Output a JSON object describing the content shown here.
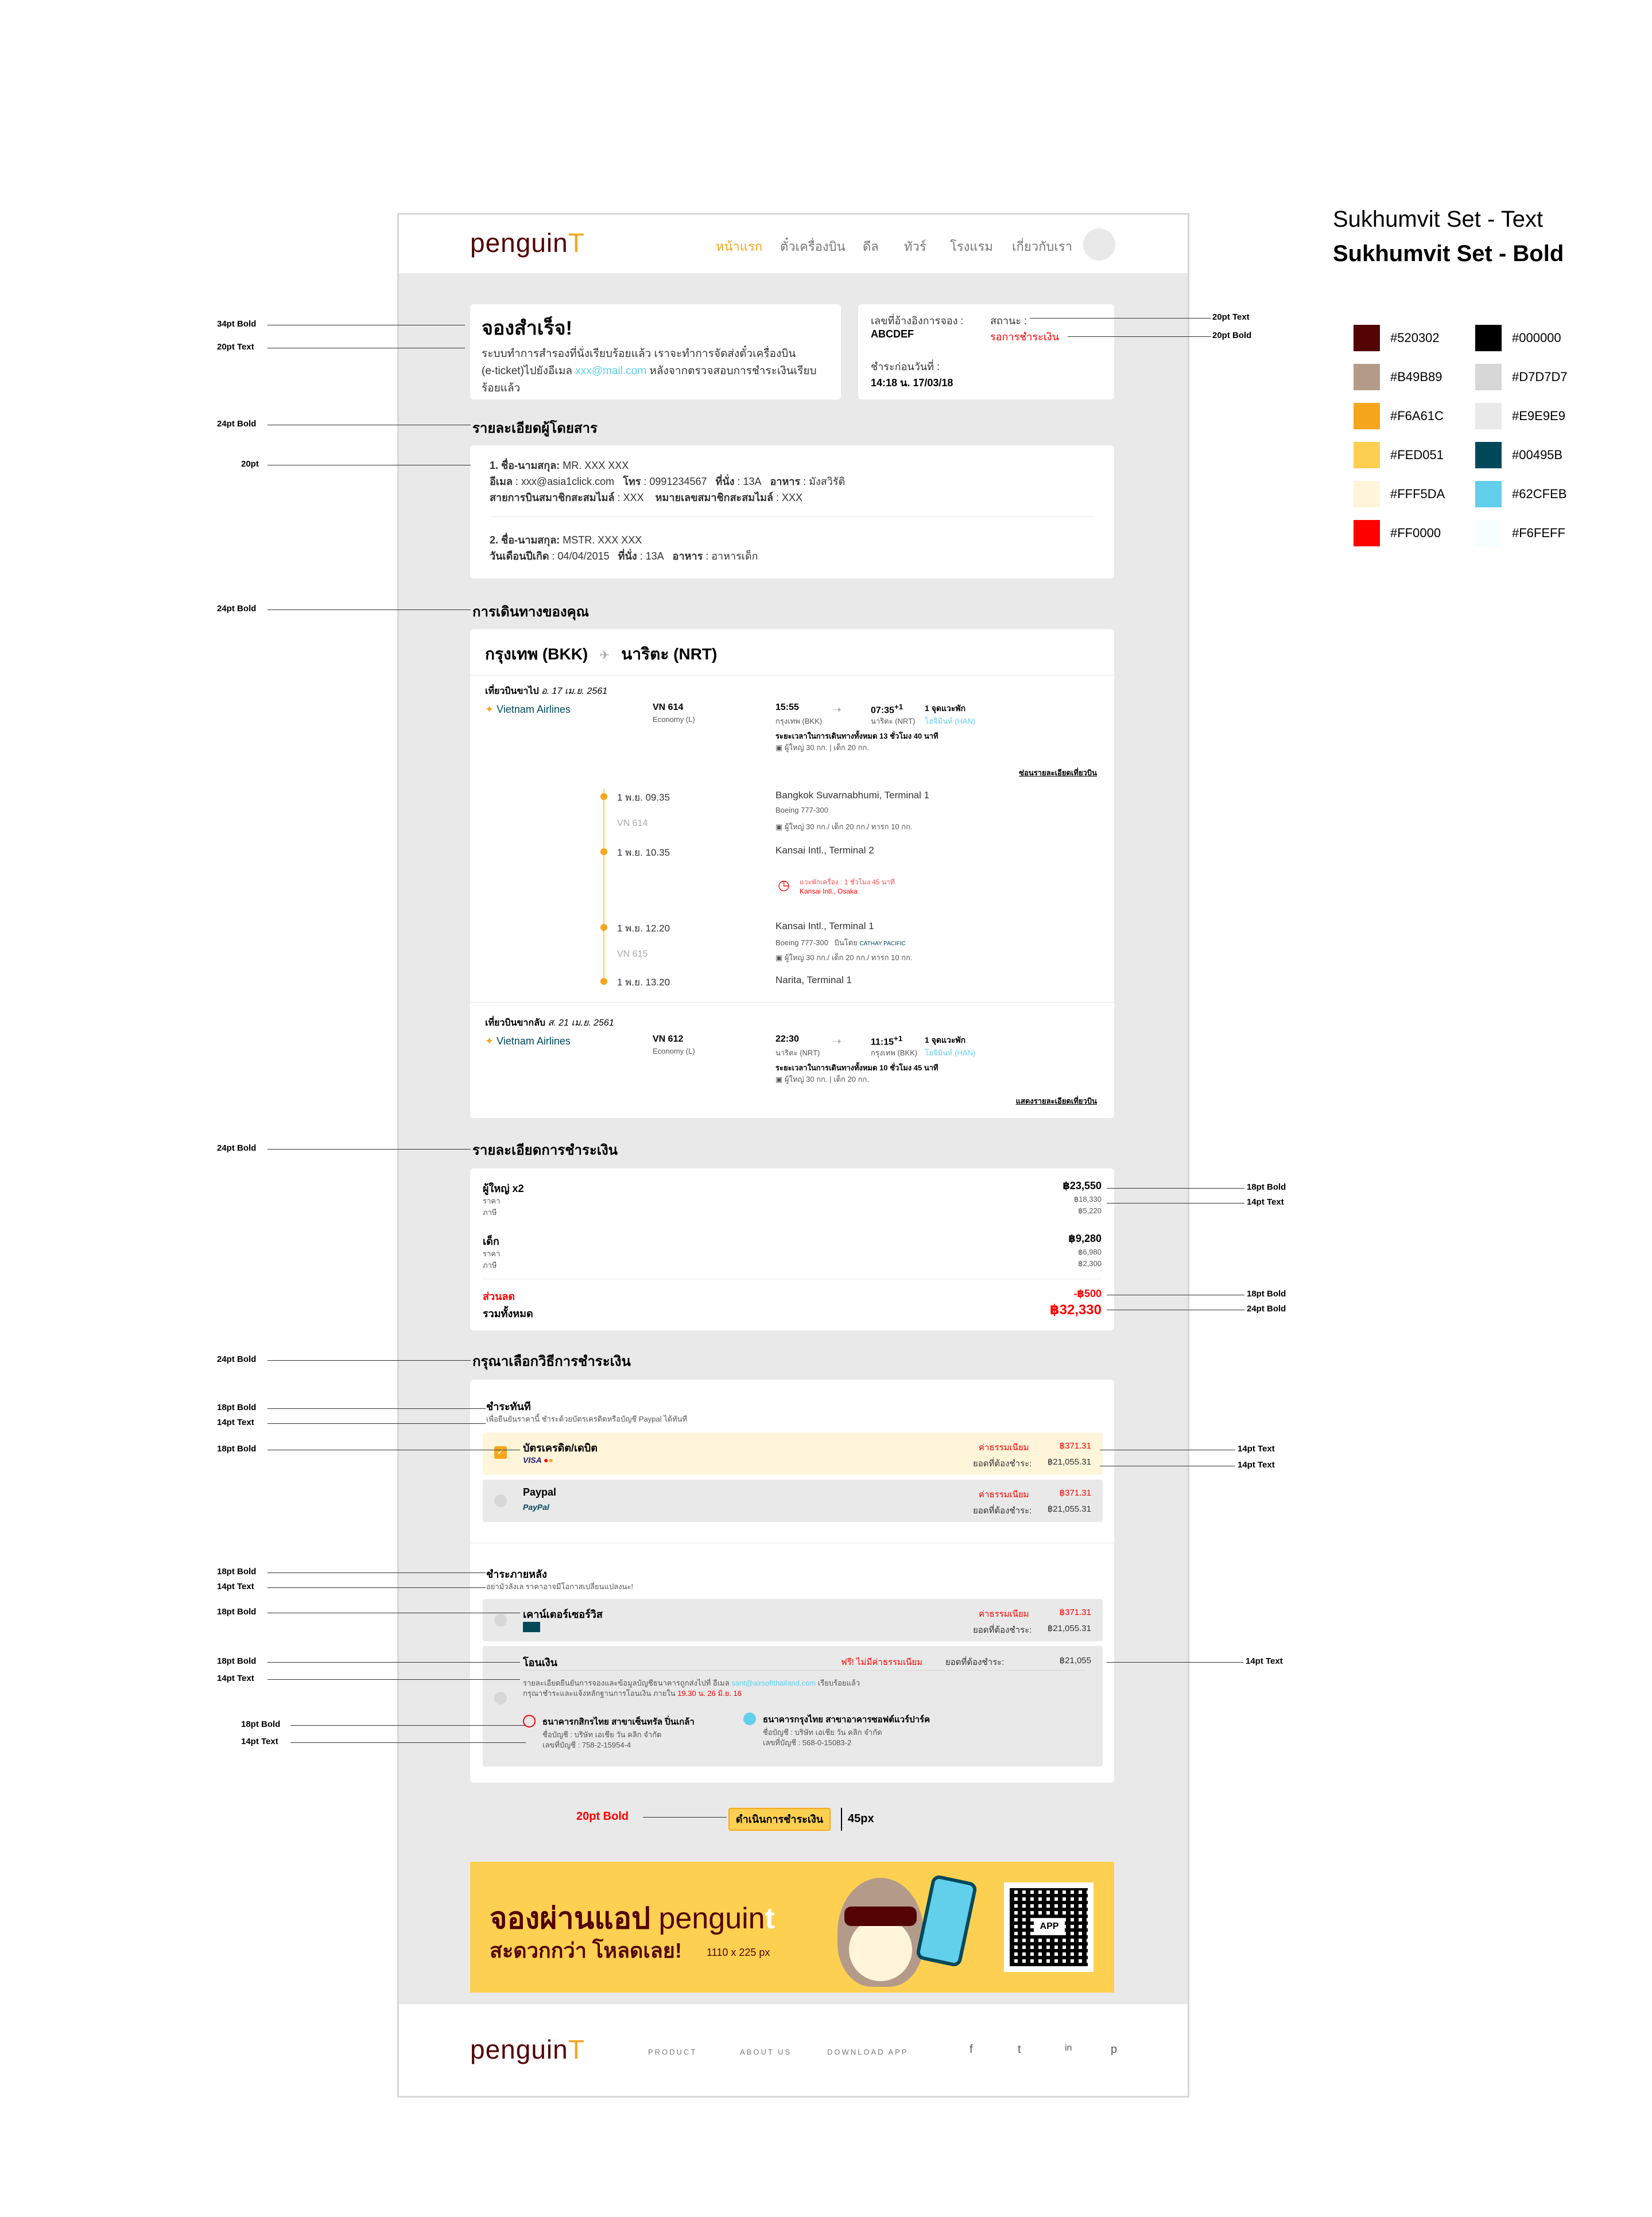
{
  "font_labels": {
    "text": "Sukhumvit Set - Text",
    "bold": "Sukhumvit Set - Bold"
  },
  "swatches": [
    {
      "hex": "#520302",
      "label": "#520302"
    },
    {
      "hex": "#000000",
      "label": "#000000"
    },
    {
      "hex": "#B49B89",
      "label": "#B49B89"
    },
    {
      "hex": "#D7D7D7",
      "label": "#D7D7D7"
    },
    {
      "hex": "#F6A61C",
      "label": "#F6A61C"
    },
    {
      "hex": "#E9E9E9",
      "label": "#E9E9E9"
    },
    {
      "hex": "#FED051",
      "label": "#FED051"
    },
    {
      "hex": "#00495B",
      "label": "#00495B"
    },
    {
      "hex": "#FFF5DA",
      "label": "#FFF5DA"
    },
    {
      "hex": "#62CFEB",
      "label": "#62CFEB"
    },
    {
      "hex": "#FF0000",
      "label": "#FF0000"
    },
    {
      "hex": "#F6FEFF",
      "label": "#F6FEFF"
    }
  ],
  "header": {
    "logo": "penguin",
    "logo_t": "T",
    "nav": [
      "หน้าแรก",
      "ตั๋วเครื่องบิน",
      "ดีล",
      "ทัวร์",
      "โรงแรม",
      "เกี่ยวกับเรา"
    ]
  },
  "success": {
    "title": "จองสำเร็จ!",
    "line1": "ระบบทำการสำรองที่นั่งเรียบร้อยแล้ว เราจะทำการจัดส่งตั๋วเครื่องบิน",
    "line2_a": "(e-ticket)ไปยังอีเมล ",
    "line2_email": "xxx@mail.com",
    "line2_b": " หลังจากตรวจสอบการชำระเงินเรียบ",
    "line3": "ร้อยแล้ว"
  },
  "booking": {
    "ref_label": "เลขที่อ้างอิงการจอง :",
    "ref_value": "ABCDEF",
    "status_label": "สถานะ :",
    "status_value": "รอการชำระเงิน",
    "due_label": "ชำระก่อนวันที่ :",
    "due_value": "14:18 น. 17/03/18"
  },
  "passenger_section": "รายละเอียดผู้โดยสาร",
  "passengers": [
    {
      "line1_label": "1. ชื่อ-นามสกุล:",
      "line1_value": " MR. XXX XXX",
      "email_label": "อีเมล",
      "email_value": " : xxx@asia1click.com",
      "tel_label": "โทร",
      "tel_value": " : 0991234567",
      "seat_label": "ที่นั่ง",
      "seat_value": " : 13A",
      "food_label": "อาหาร",
      "food_value": " : มังสวิรัติ",
      "airline_label": "สายการบินสมาชิกสะสมไมล์",
      "airline_value": " : XXX",
      "member_label": "หมายเลขสมาชิกสะสมไมล์",
      "member_value": " : XXX"
    },
    {
      "line1_label": "2. ชื่อ-นามสกุล:",
      "line1_value": " MSTR. XXX  XXX",
      "dob_label": "วันเดือนปีเกิด",
      "dob_value": " : 04/04/2015",
      "seat_label": "ที่นั่ง",
      "seat_value": " : 13A",
      "food_label": "อาหาร",
      "food_value": " : อาหารเด็ก"
    }
  ],
  "trip_section": "การเดินทางของคุณ",
  "trip": {
    "origin": "กรุงเทพ (BKK)",
    "dest": "นาริตะ (NRT)",
    "outbound": {
      "label": "เที่ยวบินขาไป",
      "date": "อ. 17 เม.ย. 2561",
      "airline": "Vietnam Airlines",
      "flight": "VN 614",
      "cabin": "Economy (L)",
      "dep_time": "15:55",
      "dep_place": "กรุงเทพ (BKK)",
      "arr_time": "07:35",
      "arr_plus": "+1",
      "arr_place": "นาริตะ (NRT)",
      "stops": "1 จุดแวะพัก",
      "stop_place": "โฮจิมินห์ (HAN)",
      "duration": "ระยะเวลาในการเดินทางทั้งหมด 13 ชั่วโมง 40 นาที",
      "baggage": "ผู้ใหญ่ 30 กก. | เด็ก 20 กก.",
      "detail_link": "ซ่อนรายละเอียดเที่ยวบิน"
    },
    "legs": [
      {
        "time": "1 พ.ย. 09.35",
        "place": "Bangkok Suvarnabhumi, Terminal 1",
        "aircraft": "Boeing 777-300",
        "flight": "VN 614",
        "baggage": "ผู้ใหญ่ 30 กก./ เด็ก 20 กก./ ทารก 10 กก.",
        "arr_time": "1 พ.ย. 10.35",
        "arr_place": "Kansai Intl., Terminal 2"
      },
      {
        "time": "1 พ.ย. 12.20",
        "place": "Kansai Intl., Terminal 1",
        "aircraft": "Boeing 777-300",
        "operated": "บินโดย",
        "operator": "CATHAY PACIFIC",
        "flight": "VN 615",
        "baggage": "ผู้ใหญ่ 30 กก./ เด็ก 20 กก./ ทารก 10 กก.",
        "arr_time": "1 พ.ย. 13.20",
        "arr_place": "Narita, Terminal 1"
      }
    ],
    "layover": {
      "text": "แวะพักเครื่อง : 1 ชั่วโมง 45 นาที",
      "place": "Kansai Intl., Osaka"
    },
    "inbound": {
      "label": "เที่ยวบินขากลับ",
      "date": "ส. 21 เม.ย. 2561",
      "airline": "Vietnam Airlines",
      "flight": "VN 612",
      "cabin": "Economy (L)",
      "dep_time": "22:30",
      "dep_place": "นาริตะ (NRT)",
      "arr_time": "11:15",
      "arr_plus": "+1",
      "arr_place": "กรุงเทพ (BKK)",
      "stops": "1 จุดแวะพัก",
      "stop_place": "โฮจิมินห์ (HAN)",
      "duration": "ระยะเวลาในการเดินทางทั้งหมด 10 ชั่วโมง 45 นาที",
      "baggage": "ผู้ใหญ่ 30 กก. | เด็ก 20 กก.",
      "detail_link": "แสดงรายละเอียดเที่ยวบิน"
    }
  },
  "price_section": "รายละเอียดการชำระเงิน",
  "price": {
    "adult_label": "ผู้ใหญ่ x2",
    "adult_total": "฿23,550",
    "adult_fare_label": "ราคา",
    "adult_fare": "฿18,330",
    "adult_tax_label": "ภาษี",
    "adult_tax": "฿5,220",
    "child_label": "เด็ก",
    "child_total": "฿9,280",
    "child_fare_label": "ราคา",
    "child_fare": "฿6,980",
    "child_tax_label": "ภาษี",
    "child_tax": "฿2,300",
    "discount_label": "ส่วนลด",
    "discount": "-฿500",
    "total_label": "รวมทั้งหมด",
    "total": "฿32,330"
  },
  "method_section": "กรุณาเลือกวิธีการชำระเงิน",
  "pay_now": {
    "title": "ชำระทันที",
    "desc": "เพื่อยืนยันราคานี้ ชำระด้วยบัตรเครดิตหรือบัญชี Paypal ได้ทันที",
    "card_label": "บัตรเครดิต/เดบิต",
    "card_brands": "VISA",
    "paypal_label": "Paypal",
    "paypal_brand": "PayPal",
    "fee_label": "ค่าธรรมเนียม",
    "fee": "฿371.31",
    "due_label": "ยอดที่ต้องชำระ:",
    "due": "฿21,055.31"
  },
  "pay_later": {
    "title": "ชำระภายหลัง",
    "desc": "อย่ามัวลังเล ราคาอาจมีโอกาสเปลี่ยนแปลงนะ!",
    "counter_label": "เคาน์เตอร์เซอร์วิส",
    "fee_label": "ค่าธรรมเนียม",
    "fee": "฿371.31",
    "due_label": "ยอดที่ต้องชำระ:",
    "due": "฿21,055.31",
    "transfer_label": "โอนเงิน",
    "transfer_free": "ฟรี! ไม่มีค่าธรรมเนียม",
    "transfer_due_label": "ยอดที่ต้องชำระ:",
    "transfer_due": "฿21,055",
    "transfer_desc1_a": "รายละเอียดยืนยันการจองและข้อมูลบัญชีธนาคารถูกส่งไปที่  อีเมล ",
    "transfer_desc1_email": "sant@airsoftthailand.com",
    "transfer_desc1_b": " เรียบร้อยแล้ว",
    "transfer_desc2_a": "กรุณาชำระและแจ้งหลักฐานการโอนเงิน ภายใน ",
    "transfer_desc2_red": "19.30 น. 26 มิ.ย. 16",
    "bank1_name": "ธนาคารกสิกรไทย สาขาเซ็นทรัล ปิ่นเกล้า",
    "bank1_acc_name": "ชื่อบัญชี : บริษัท เอเชีย วัน คลิก จำกัด",
    "bank1_acc_no": "เลขที่บัญชี : 758-2-15954-4",
    "bank2_name": "ธนาคารกรุงไทย สาขาอาคารซอฟต์แวร์ปาร์ค",
    "bank2_acc_name": "ชื่อบัญชี : บริษัท เอเชีย วัน คลิก จำกัด",
    "bank2_acc_no": "เลขที่บัญชี : 568-0-15083-2"
  },
  "cta": {
    "label": "ดำเนินการชำระเงิน",
    "height_note": "45px"
  },
  "banner": {
    "line1": "จองผ่านแอป",
    "brand": "penguin",
    "brand_t": "t",
    "line2": "สะดวกกว่า โหลดเลย!",
    "size_note": "1110 x 225 px",
    "app_label": "APP"
  },
  "footer": {
    "logo": "penguin",
    "logo_t": "T",
    "links": [
      "PRODUCT",
      "ABOUT US",
      "DOWNLOAD APP"
    ],
    "icons": [
      "f",
      "t",
      "in",
      "p"
    ]
  },
  "annotations": {
    "a34b": "34pt Bold",
    "a20t": "20pt Text",
    "a24b": "24pt Bold",
    "a20": "20pt",
    "a18b": "18pt Bold",
    "a14t": "14pt Text",
    "a20b": "20pt Bold",
    "a45": "45px",
    "a20tR": "20pt Text",
    "a20bR": "20pt Bold"
  }
}
